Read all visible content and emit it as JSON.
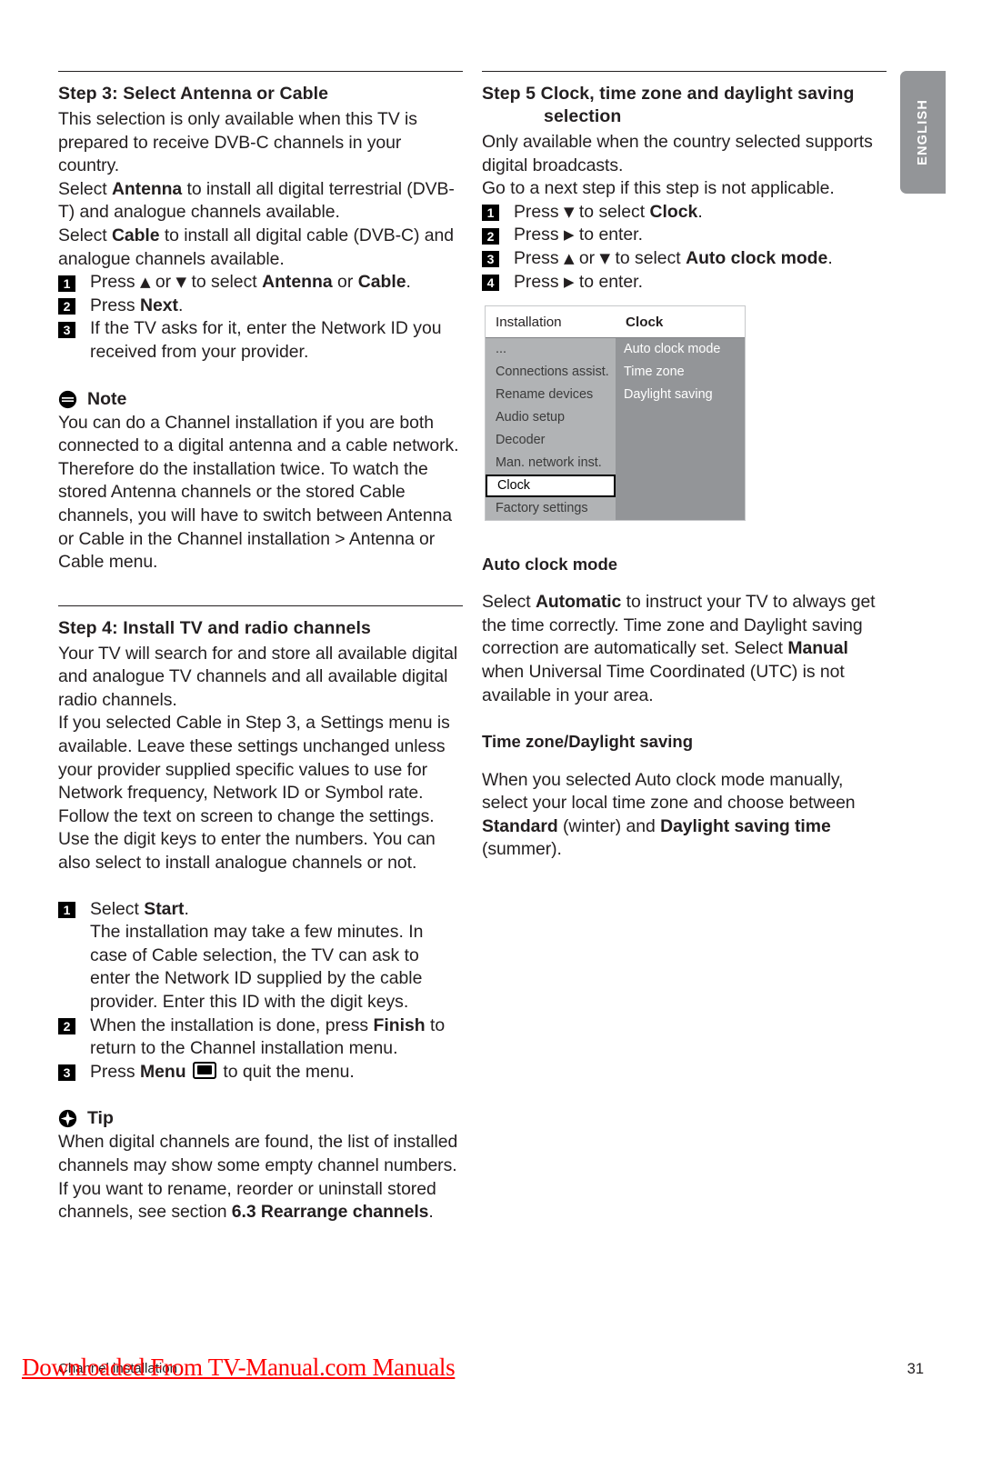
{
  "language_tab": {
    "label": "ENGLISH"
  },
  "left_column": {
    "step3": {
      "heading": "Step 3:  Select Antenna or Cable",
      "paragraphs": [
        "This selection is only available when this TV is prepared to receive DVB-C channels in your country.",
        "Select Antenna to install all digital terrestrial (DVB-T) and analogue channels available.",
        "Select Cable to install all digital cable (DVB-C) and analogue channels available."
      ],
      "steps": [
        {
          "num": "1",
          "text": "Press ▲ or ▼ to select Antenna or Cable."
        },
        {
          "num": "2",
          "text": "Press Next."
        },
        {
          "num": "3",
          "text": "If the TV asks for it, enter the Network ID you received from your provider."
        }
      ]
    },
    "note": {
      "icon": "note-icon",
      "label": "Note",
      "text": "You can do a Channel installation if you are both connected to a digital antenna and a cable network. Therefore do the installation twice. To watch the stored Antenna channels or the stored Cable channels, you will have to switch between Antenna or Cable in the Channel installation > Antenna or Cable menu."
    },
    "step4": {
      "heading": "Step 4: Install TV and radio channels",
      "paragraph1": "Your TV will search for and store all available digital and analogue TV channels and all available digital radio channels.",
      "paragraph2": "If you selected Cable in Step 3, a Settings menu is available. Leave these settings unchanged unless your provider supplied specific values to use for Network frequency, Network ID or Symbol rate. Follow the text on screen to change the settings. Use the digit keys to enter the numbers. You can also select to install analogue channels or not.",
      "steps": [
        {
          "num": "1",
          "lead": "Select Start.",
          "sub": "The installation may take a few minutes. In case of Cable selection, the TV can ask to enter the Network ID supplied by the cable provider. Enter this ID with the digit keys."
        },
        {
          "num": "2",
          "lead": "When the installation is done, press Finish to return to the Channel installation menu."
        },
        {
          "num": "3",
          "lead": "Press Menu ■ to quit the menu."
        }
      ]
    },
    "tip": {
      "icon": "tip-icon",
      "label": "Tip",
      "text": "When digital channels are found, the list of installed channels may show some empty channel numbers. If you want to rename, reorder or uninstall stored channels, see section 6.3 Rearrange channels."
    }
  },
  "right_column": {
    "step5": {
      "heading_line1": "Step 5  Clock, time zone and daylight saving",
      "heading_line2": "selection",
      "paragraphs": [
        "Only available when the country selected supports digital broadcasts.",
        "Go to a next step if this step is not applicable."
      ],
      "steps": [
        {
          "num": "1",
          "text": "Press ▼ to select Clock."
        },
        {
          "num": "2",
          "text": "Press ▶ to enter."
        },
        {
          "num": "3",
          "text": "Press ▲ or ▼ to select Auto clock mode."
        },
        {
          "num": "4",
          "text": "Press ▶ to enter."
        }
      ]
    },
    "tv_menu": {
      "header_left": "Installation",
      "header_right": "Clock",
      "rows": [
        {
          "left": "...",
          "right": "Auto clock mode",
          "right_filled": true,
          "selected": false
        },
        {
          "left": "Connections assist.",
          "right": "Time zone",
          "right_filled": true,
          "selected": false
        },
        {
          "left": "Rename devices",
          "right": "Daylight saving",
          "right_filled": true,
          "selected": false
        },
        {
          "left": "Audio setup",
          "right": "",
          "right_filled": false,
          "selected": false
        },
        {
          "left": "Decoder",
          "right": "",
          "right_filled": false,
          "selected": false
        },
        {
          "left": "Man. network inst.",
          "right": "",
          "right_filled": false,
          "selected": false
        },
        {
          "left": "Clock",
          "right": "",
          "right_filled": false,
          "selected": true
        },
        {
          "left": "Factory settings",
          "right": "",
          "right_filled": false,
          "selected": false
        }
      ]
    },
    "auto_clock_mode": {
      "heading": "Auto clock mode",
      "text": "Select Automatic to instruct your TV to always get the time correctly. Time zone and Daylight saving correction are automatically set. Select Manual when Universal Time Coordinated (UTC) is not available in your area."
    },
    "time_zone": {
      "heading": "Time zone/Daylight saving",
      "text": "When you selected Auto clock mode manually, select your local time zone and choose between Standard (winter) and Daylight saving time (summer)."
    }
  },
  "footer": {
    "caption": "Channel installation",
    "page_number": "31",
    "watermark": "Downloaded From TV-Manual.com Manuals"
  }
}
